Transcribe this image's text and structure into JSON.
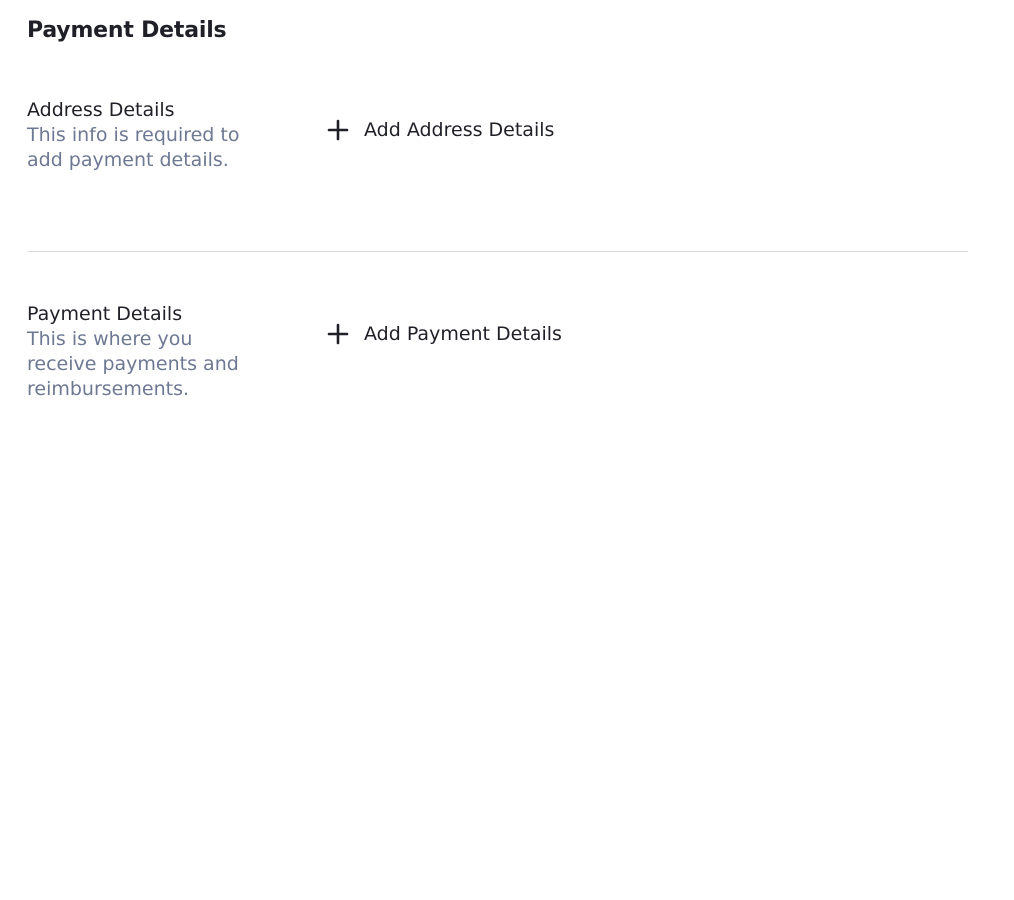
{
  "page": {
    "title": "Payment Details"
  },
  "sections": [
    {
      "heading": "Address Details",
      "description": "This info is required to add payment details.",
      "action_label": "Add Address Details",
      "action_icon": "plus-icon"
    },
    {
      "heading": "Payment Details",
      "description": "This is where you receive payments and reimbursements.",
      "action_label": "Add Payment Details",
      "action_icon": "plus-icon"
    }
  ],
  "colors": {
    "text_primary": "#1f1f28",
    "text_secondary": "#6d7892",
    "divider": "#dcdcdf",
    "background": "#ffffff"
  }
}
